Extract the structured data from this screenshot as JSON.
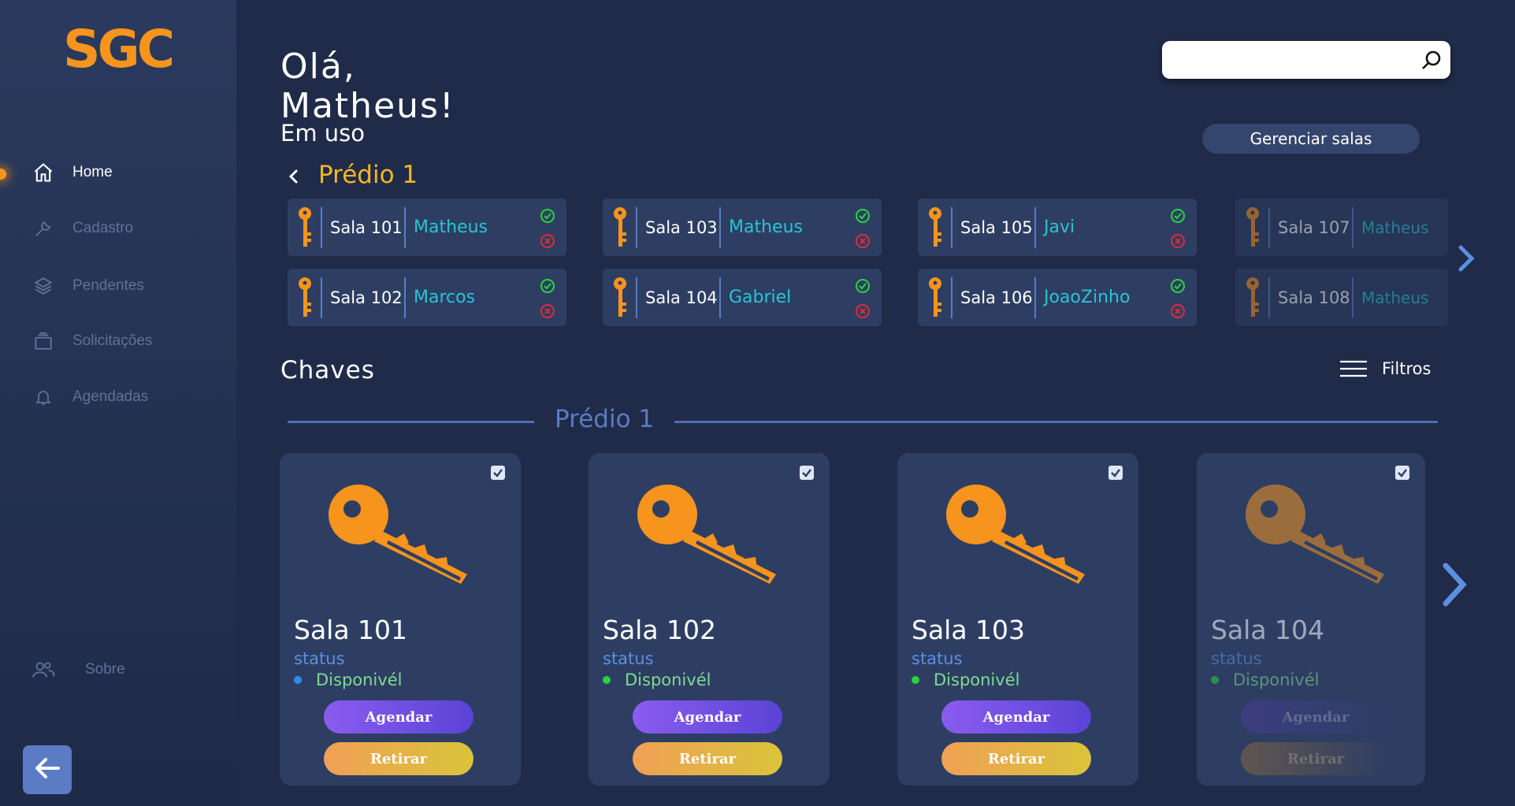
{
  "logo": {
    "text": "SGC"
  },
  "sidebar": {
    "items": [
      {
        "label": "Home",
        "icon": "home-icon"
      },
      {
        "label": "Cadastro",
        "icon": "wrench-icon"
      },
      {
        "label": "Pendentes",
        "icon": "layers-icon"
      },
      {
        "label": "Solicitações",
        "icon": "tray-icon"
      },
      {
        "label": "Agendadas",
        "icon": "bell-icon"
      }
    ],
    "about": {
      "label": "Sobre",
      "icon": "users-icon"
    }
  },
  "header": {
    "greeting_line1": "Olá,",
    "greeting_line2": "Matheus!",
    "in_use_title": "Em uso",
    "search_placeholder": "",
    "manage_button": "Gerenciar salas"
  },
  "in_use": {
    "building": "Prédio 1",
    "rooms": [
      {
        "room": "Sala 101",
        "user": "Matheus"
      },
      {
        "room": "Sala 102",
        "user": "Marcos"
      },
      {
        "room": "Sala 103",
        "user": "Matheus"
      },
      {
        "room": "Sala 104",
        "user": "Gabriel"
      },
      {
        "room": "Sala 105",
        "user": "Javi"
      },
      {
        "room": "Sala 106",
        "user": "JoaoZinho"
      },
      {
        "room": "Sala 107",
        "user": "Matheus"
      },
      {
        "room": "Sala 108",
        "user": "Matheus"
      }
    ]
  },
  "keys": {
    "title": "Chaves",
    "filters_label": "Filtros",
    "building": "Prédio 1",
    "cards": [
      {
        "name": "Sala 101",
        "status_label": "status",
        "availability": "Disponivél",
        "dot_color": "#2f8fe8",
        "schedule": "Agendar",
        "withdraw": "Retirar"
      },
      {
        "name": "Sala 102",
        "status_label": "status",
        "availability": "Disponivél",
        "dot_color": "#28d43a",
        "schedule": "Agendar",
        "withdraw": "Retirar"
      },
      {
        "name": "Sala 103",
        "status_label": "status",
        "availability": "Disponivél",
        "dot_color": "#28d43a",
        "schedule": "Agendar",
        "withdraw": "Retirar"
      },
      {
        "name": "Sala 104",
        "status_label": "status",
        "availability": "Disponivél",
        "dot_color": "#28d43a",
        "schedule": "Agendar",
        "withdraw": "Retirar"
      }
    ]
  },
  "colors": {
    "accent": "#f7941d",
    "building_title": "#f5b820",
    "user_name": "#29c4d3",
    "confirm": "#28d43a",
    "reject": "#e02a3a"
  }
}
